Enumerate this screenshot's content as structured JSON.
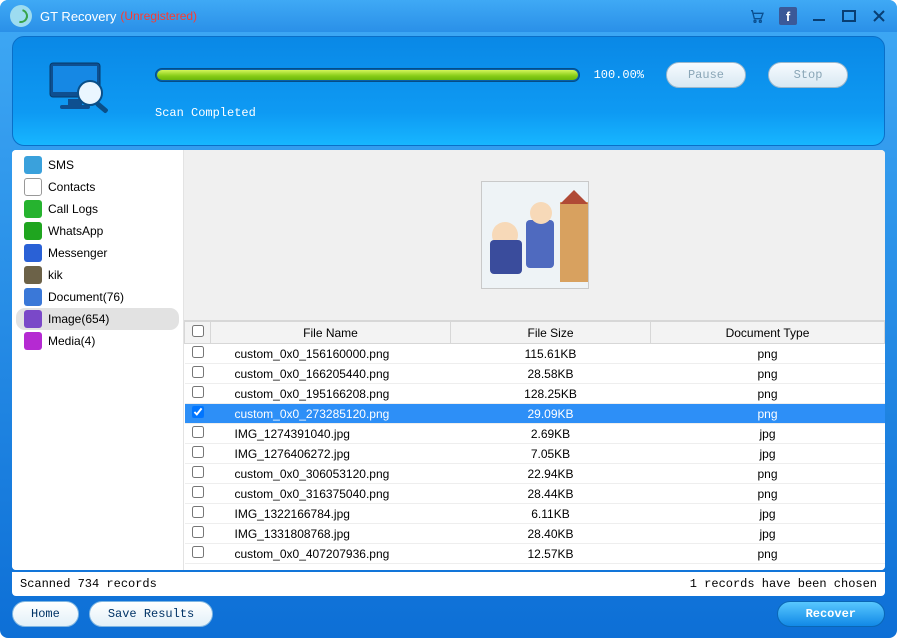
{
  "title": {
    "main": "GT Recovery",
    "suffix": "(Unregistered)"
  },
  "titlebar_icons": {
    "cart": "cart-icon",
    "fb": "f",
    "min": "–",
    "max": "□",
    "close": "X"
  },
  "progress": {
    "pct_label": "100.00%",
    "pct": 100,
    "status": "Scan Completed",
    "pause_label": "Pause",
    "stop_label": "Stop"
  },
  "sidebar": {
    "items": [
      {
        "label": "SMS",
        "icon_bg": "#3aa1dc",
        "glyph": "…"
      },
      {
        "label": "Contacts",
        "icon_bg": "#ffffff",
        "glyph": ""
      },
      {
        "label": "Call Logs",
        "icon_bg": "#26b32f",
        "glyph": ""
      },
      {
        "label": "WhatsApp",
        "icon_bg": "#1fa51f",
        "glyph": ""
      },
      {
        "label": "Messenger",
        "icon_bg": "#2a61d6",
        "glyph": ""
      },
      {
        "label": "kik",
        "icon_bg": "#6c6248",
        "glyph": ""
      },
      {
        "label": "Document(76)",
        "icon_bg": "#3a78d8",
        "glyph": ""
      },
      {
        "label": "Image(654)",
        "icon_bg": "#7a48c8",
        "glyph": ""
      },
      {
        "label": "Media(4)",
        "icon_bg": "#b52ad2",
        "glyph": ""
      }
    ],
    "selected_index": 7
  },
  "table": {
    "headers": {
      "name": "File Name",
      "size": "File Size",
      "type": "Document Type"
    },
    "rows": [
      {
        "name": "custom_0x0_156160000.png",
        "size": "115.61KB",
        "type": "png",
        "checked": false,
        "selected": false
      },
      {
        "name": "custom_0x0_166205440.png",
        "size": "28.58KB",
        "type": "png",
        "checked": false,
        "selected": false
      },
      {
        "name": "custom_0x0_195166208.png",
        "size": "128.25KB",
        "type": "png",
        "checked": false,
        "selected": false
      },
      {
        "name": "custom_0x0_273285120.png",
        "size": "29.09KB",
        "type": "png",
        "checked": true,
        "selected": true
      },
      {
        "name": "IMG_1274391040.jpg",
        "size": "2.69KB",
        "type": "jpg",
        "checked": false,
        "selected": false
      },
      {
        "name": "IMG_1276406272.jpg",
        "size": "7.05KB",
        "type": "jpg",
        "checked": false,
        "selected": false
      },
      {
        "name": "custom_0x0_306053120.png",
        "size": "22.94KB",
        "type": "png",
        "checked": false,
        "selected": false
      },
      {
        "name": "custom_0x0_316375040.png",
        "size": "28.44KB",
        "type": "png",
        "checked": false,
        "selected": false
      },
      {
        "name": "IMG_1322166784.jpg",
        "size": "6.11KB",
        "type": "jpg",
        "checked": false,
        "selected": false
      },
      {
        "name": "IMG_1331808768.jpg",
        "size": "28.40KB",
        "type": "jpg",
        "checked": false,
        "selected": false
      },
      {
        "name": "custom_0x0_407207936.png",
        "size": "12.57KB",
        "type": "png",
        "checked": false,
        "selected": false
      }
    ]
  },
  "status": {
    "left": "Scanned 734 records",
    "right": "1 records have been chosen"
  },
  "buttons": {
    "home": "Home",
    "save": "Save Results",
    "recover": "Recover"
  }
}
